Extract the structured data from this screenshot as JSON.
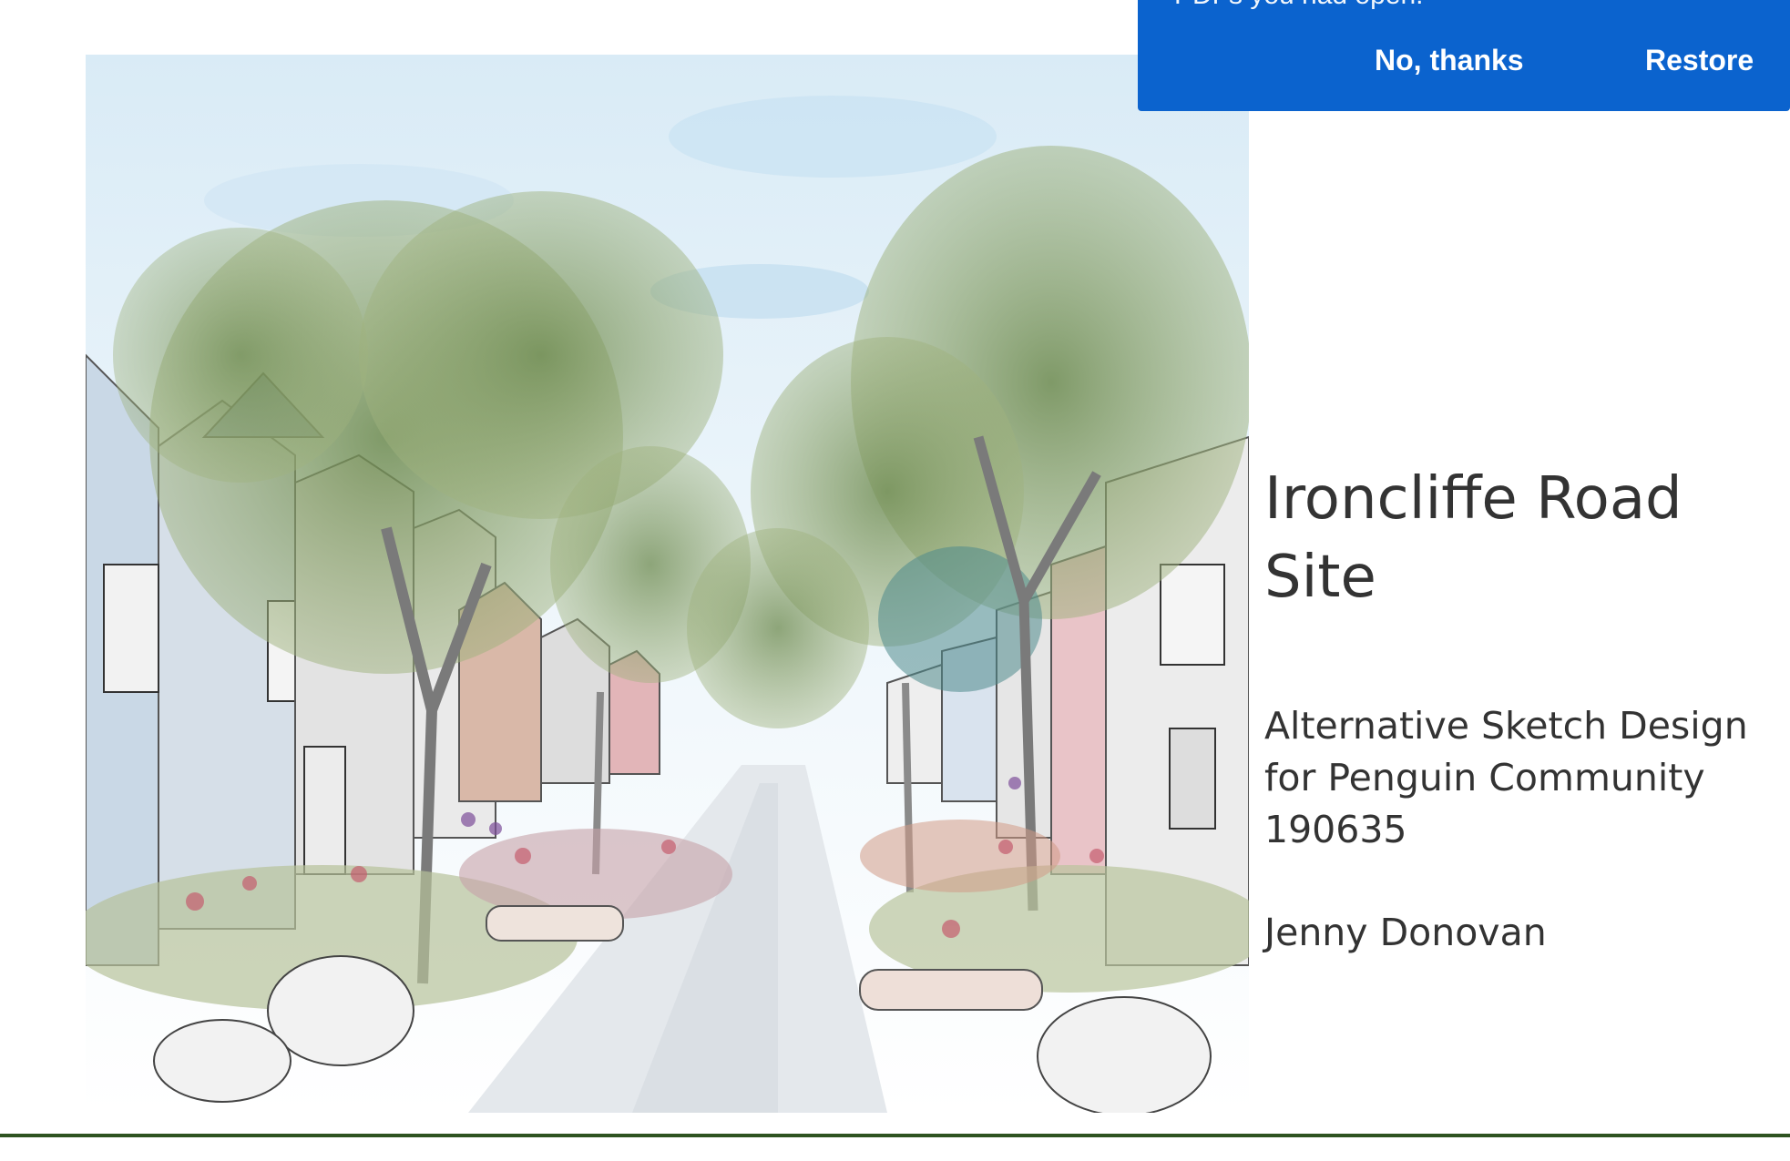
{
  "notification": {
    "message": "PDFs you had open.",
    "dismiss_label": "No, thanks",
    "restore_label": "Restore",
    "background_color": "#0b63ce"
  },
  "slide": {
    "title": "Ironcliffe Road Site",
    "subtitle_lines": [
      "Alternative Sketch Design",
      "for Penguin Community",
      "190635"
    ],
    "author": "Jenny Donovan",
    "text_color": "#333333",
    "rule_color": "#2e5321"
  },
  "illustration": {
    "kind": "street-sketch-artwork"
  }
}
